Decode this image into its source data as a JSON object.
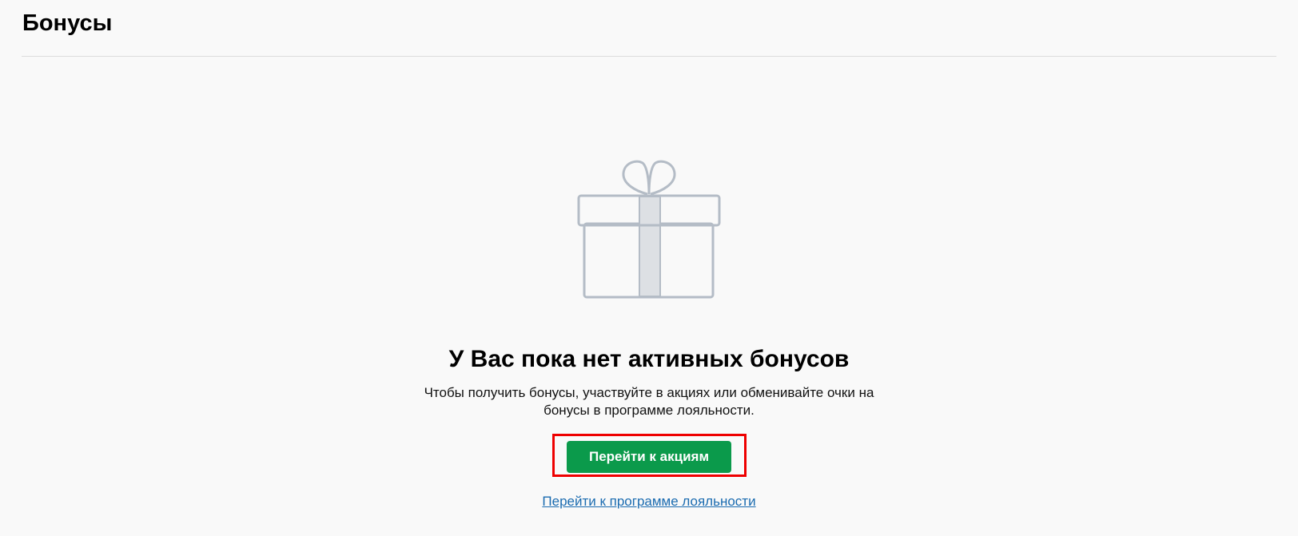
{
  "header": {
    "title": "Бонусы"
  },
  "empty_state": {
    "icon": "gift-icon",
    "title": "У Вас пока нет активных бонусов",
    "description": "Чтобы получить бонусы, участвуйте в акциях или обменивайте очки на бонусы в программе лояльности.",
    "primary_button_label": "Перейти к акциям",
    "secondary_link_label": "Перейти к программе лояльности"
  },
  "colors": {
    "primary_button": "#0b9a4b",
    "link": "#1a6bb0",
    "icon_stroke": "#b4bcc6",
    "icon_ribbon": "#dde0e4",
    "highlight": "#ee0000"
  }
}
